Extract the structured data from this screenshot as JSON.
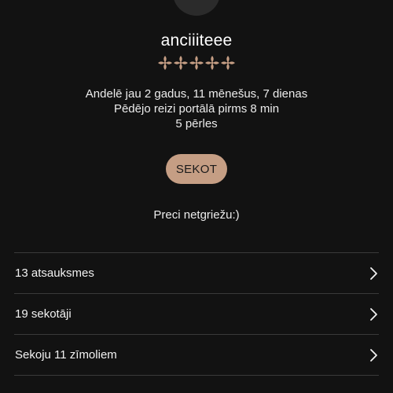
{
  "profile": {
    "username": "anciiiteee",
    "rating": {
      "value": 5,
      "max": 5,
      "color": "#c59e84",
      "icon": "flower-star-icon"
    },
    "info_lines": [
      "Andelē jau 2 gadus, 11 mēnešus, 7 dienas",
      "Pēdējo reizi portālā pirms 8 min",
      "5 pērles"
    ],
    "follow_label": "SEKOT",
    "bio": "Preci netgriežu:)"
  },
  "stats": [
    {
      "label": "13 atsauksmes",
      "icon": "chevron-right-icon"
    },
    {
      "label": "19 sekotāji",
      "icon": "chevron-right-icon"
    },
    {
      "label": "Sekoju 11 zīmoliem",
      "icon": "chevron-right-icon"
    }
  ],
  "colors": {
    "background": "#121212",
    "accent": "#c59e84",
    "divider": "#3a3a3a"
  }
}
